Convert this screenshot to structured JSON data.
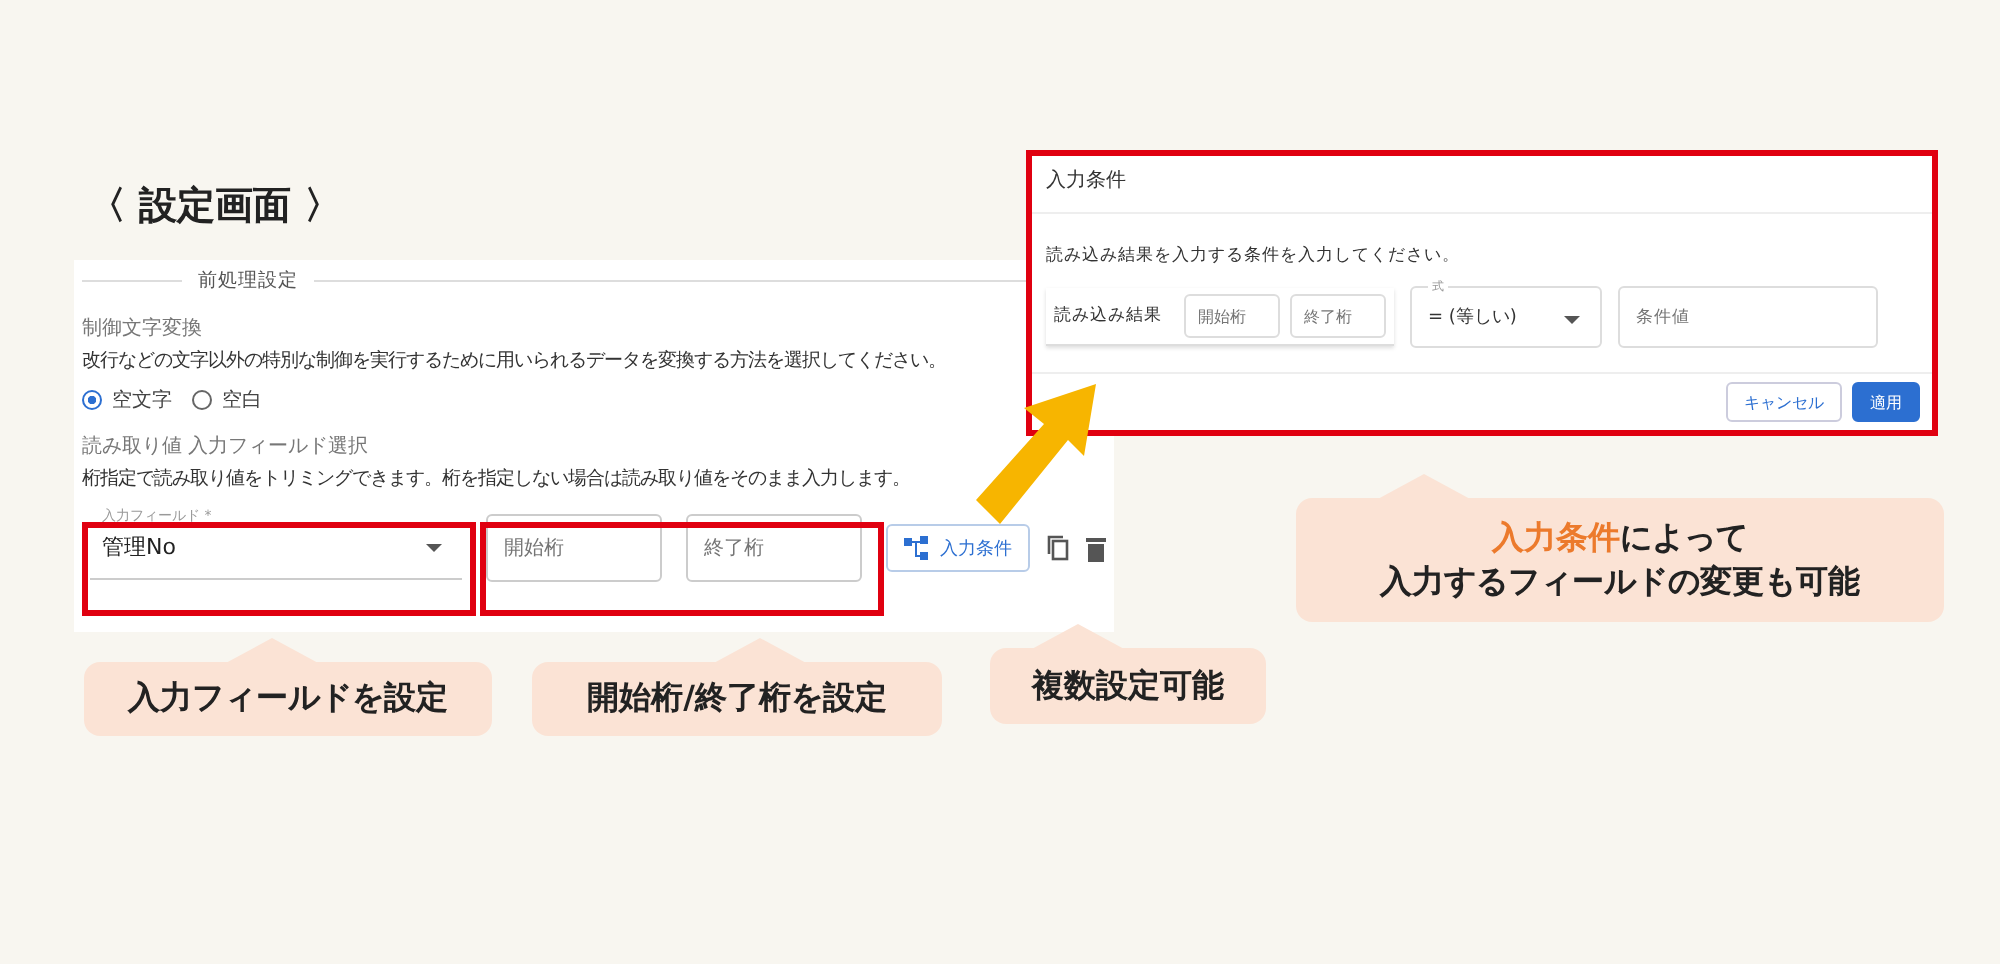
{
  "title": "〈 設定画面 〉",
  "settings": {
    "section_title": "前処理設定",
    "control_heading": "制御文字変換",
    "control_description": "改行などの文字以外の特別な制御を実行するために用いられるデータを変換する方法を選択してください。",
    "radios": [
      {
        "label": "空文字",
        "selected": true
      },
      {
        "label": "空白",
        "selected": false
      }
    ],
    "read_heading": "読み取り値 入力フィールド選択",
    "read_description": "桁指定で読み取り値をトリミングできます。桁を指定しない場合は読み取り値をそのまま入力します。",
    "field": {
      "label": "入力フィールド *",
      "value": "管理No"
    },
    "start_placeholder": "開始桁",
    "end_placeholder": "終了桁",
    "condition_button": "入力条件"
  },
  "dialog": {
    "title": "入力条件",
    "instruction": "読み込み結果を入力する条件を入力してください。",
    "group_label": "読み込み結果",
    "start_placeholder": "開始桁",
    "end_placeholder": "終了桁",
    "operator": {
      "label": "式",
      "value": "= (等しい)"
    },
    "value_placeholder": "条件値",
    "buttons": [
      {
        "label": "キャンセル",
        "kind": "secondary"
      },
      {
        "label": "適用",
        "kind": "primary"
      }
    ]
  },
  "callouts": [
    {
      "text": "入力フィールドを設定"
    },
    {
      "text": "開始桁/終了桁を設定"
    },
    {
      "text": "複数設定可能"
    },
    {
      "accent": "入力条件",
      "text": "によって",
      "text_2": "入力するフィールドの変更も可能"
    }
  ]
}
